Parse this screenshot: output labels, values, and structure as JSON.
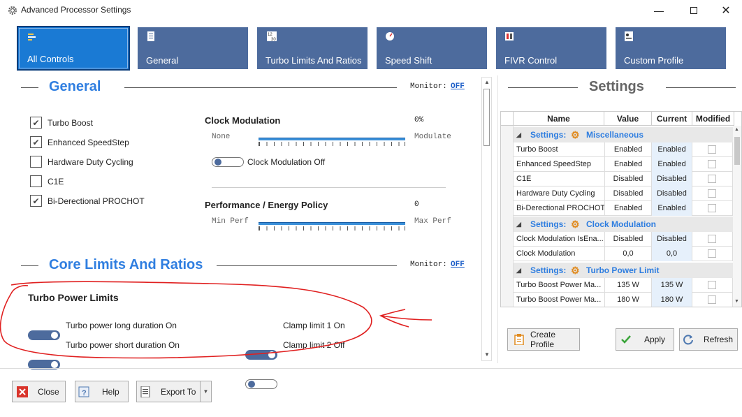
{
  "window": {
    "title": "Advanced Processor Settings"
  },
  "tabs": [
    {
      "label": "All Controls"
    },
    {
      "label": "General"
    },
    {
      "label": "Turbo Limits And Ratios"
    },
    {
      "label": "Speed Shift"
    },
    {
      "label": "FIVR Control"
    },
    {
      "label": "Custom Profile"
    }
  ],
  "general": {
    "title": "General",
    "monitor_label": "Monitor:",
    "monitor_value": "OFF",
    "checkboxes": [
      {
        "label": "Turbo Boost",
        "checked": true
      },
      {
        "label": "Enhanced SpeedStep",
        "checked": true
      },
      {
        "label": "Hardware Duty Cycling",
        "checked": false
      },
      {
        "label": "C1E",
        "checked": false
      },
      {
        "label": "Bi-Derectional PROCHOT",
        "checked": true
      }
    ],
    "clock_modulation": {
      "title": "Clock Modulation",
      "value": "0%",
      "min_label": "None",
      "max_label": "Modulate",
      "toggle_label": "Clock Modulation Off",
      "toggle_on": false
    },
    "energy_policy": {
      "title": "Performance / Energy Policy",
      "value": "0",
      "min_label": "Min Perf",
      "max_label": "Max Perf"
    }
  },
  "core": {
    "title": "Core Limits And Ratios",
    "monitor_label": "Monitor:",
    "monitor_value": "OFF",
    "turbo_power_title": "Turbo Power Limits",
    "toggles": [
      {
        "label": "Turbo power long duration On",
        "on": true
      },
      {
        "label": "Turbo power short duration On",
        "on": true
      },
      {
        "label": "Clamp limit 1 On",
        "on": true
      },
      {
        "label": "Clamp limit 2 Off",
        "on": false
      }
    ]
  },
  "settings": {
    "title": "Settings",
    "columns": [
      "Name",
      "Value",
      "Current",
      "Modified"
    ],
    "groups": [
      {
        "prefix": "Settings:",
        "name": "Miscellaneous",
        "rows": [
          {
            "name": "Turbo Boost",
            "value": "Enabled",
            "current": "Enabled"
          },
          {
            "name": "Enhanced SpeedStep",
            "value": "Enabled",
            "current": "Enabled"
          },
          {
            "name": "C1E",
            "value": "Disabled",
            "current": "Disabled"
          },
          {
            "name": "Hardware Duty Cycling",
            "value": "Disabled",
            "current": "Disabled"
          },
          {
            "name": "Bi-Derectional PROCHOT",
            "value": "Enabled",
            "current": "Enabled"
          }
        ]
      },
      {
        "prefix": "Settings:",
        "name": "Clock Modulation",
        "rows": [
          {
            "name": "Clock Modulation IsEna...",
            "value": "Disabled",
            "current": "Disabled"
          },
          {
            "name": "Clock Modulation",
            "value": "0,0",
            "current": "0,0"
          }
        ]
      },
      {
        "prefix": "Settings:",
        "name": "Turbo Power Limit",
        "rows": [
          {
            "name": "Turbo Boost Power Ma...",
            "value": "135 W",
            "current": "135 W"
          },
          {
            "name": "Turbo Boost Power Ma...",
            "value": "180 W",
            "current": "180 W"
          }
        ]
      }
    ],
    "buttons": {
      "create_profile": "Create Profile",
      "apply": "Apply",
      "refresh": "Refresh"
    }
  },
  "footer": {
    "close": "Close",
    "help": "Help",
    "export": "Export To"
  },
  "colors": {
    "accent": "#2f7ee0",
    "tab": "#4d6b9d",
    "tab_active": "#1a7ad4",
    "annotation": "#e02020"
  }
}
